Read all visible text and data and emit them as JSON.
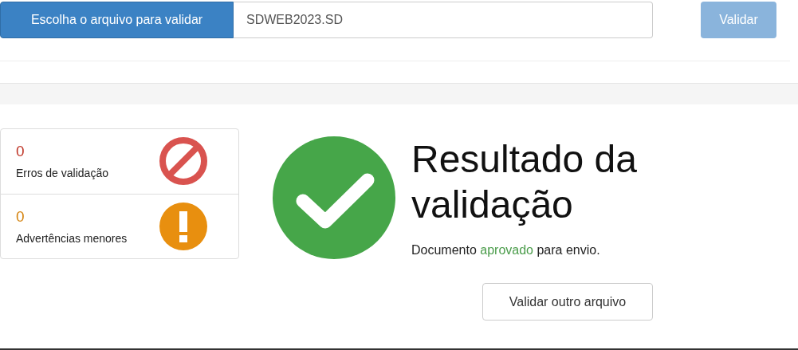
{
  "upload": {
    "choose_button": "Escolha o arquivo para validar",
    "file_name": "SDWEB2023.SD",
    "validate_button": {
      "label": "Validar",
      "disabled": true
    }
  },
  "summary": [
    {
      "kind": "error",
      "count": "0",
      "label": "Erros de validação"
    },
    {
      "kind": "warning",
      "count": "0",
      "label": "Advertências menores"
    }
  ],
  "result": {
    "title": "Resultado da validação",
    "message": {
      "before": "Documento ",
      "highlight": "aprovado",
      "after": " para envio."
    },
    "button": "Validar outro arquivo"
  }
}
